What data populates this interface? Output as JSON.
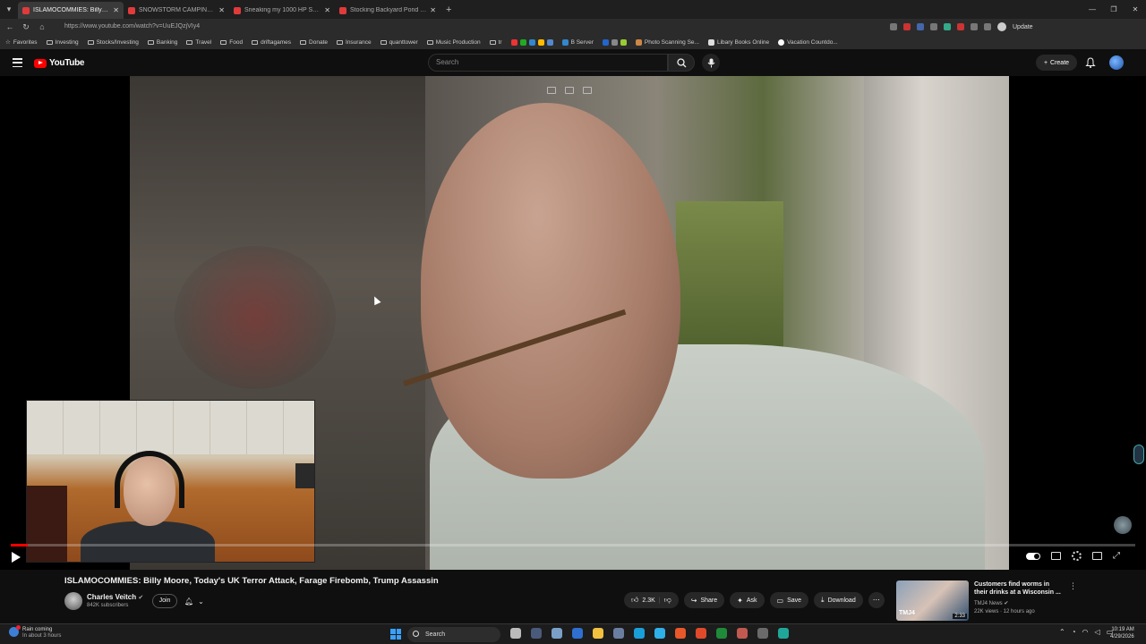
{
  "browser": {
    "tabs": [
      {
        "label": "ISLAMOCOMMIES: Billy Moore, To",
        "active": true
      },
      {
        "label": "SNOWSTORM CAMPING IN A VA",
        "active": false
      },
      {
        "label": "Sneaking my 1000 HP SUPRA wh",
        "active": false
      },
      {
        "label": "Stocking Backyard Pond With Gia",
        "active": false
      }
    ],
    "url": "https://www.youtube.com/watch?v=UuEJQzjVIy4",
    "update_label": "Update",
    "bookmarks": [
      "Favorites",
      "Investing",
      "Stocks/Investing",
      "Banking",
      "Travel",
      "Food",
      "driftagames",
      "Donate",
      "Insurance",
      "quanttower",
      "Music Production",
      "tr",
      "B Server",
      "Photo Scanning Se...",
      "Libary Books Online",
      "Vacation Countdo..."
    ]
  },
  "youtube": {
    "logo_text": "YouTube",
    "search_placeholder": "Search",
    "create_label": "Create"
  },
  "video": {
    "title": "ISLAMOCOMMIES: Billy Moore, Today's UK Terror Attack, Farage Firebomb, Trump Assassin",
    "progress_fraction": 0.015,
    "channel": {
      "name": "Charles Veitch",
      "subscribers": "842K subscribers",
      "join_label": "Join"
    },
    "actions": {
      "likes": "2.3K",
      "share": "Share",
      "ask": "Ask",
      "save": "Save",
      "download": "Download"
    }
  },
  "recommendation": {
    "title": "Customers find worms in their drinks at a Wisconsin ...",
    "channel": "TMJ4 News",
    "meta": "22K views · 12 hours ago",
    "duration": "2:33",
    "thumb_logo": "TMJ4"
  },
  "taskbar": {
    "weather_title": "Rain coming",
    "weather_sub": "In about 3 hours",
    "search_label": "Search",
    "time": "10:19 AM",
    "date": "4/29/2026"
  }
}
